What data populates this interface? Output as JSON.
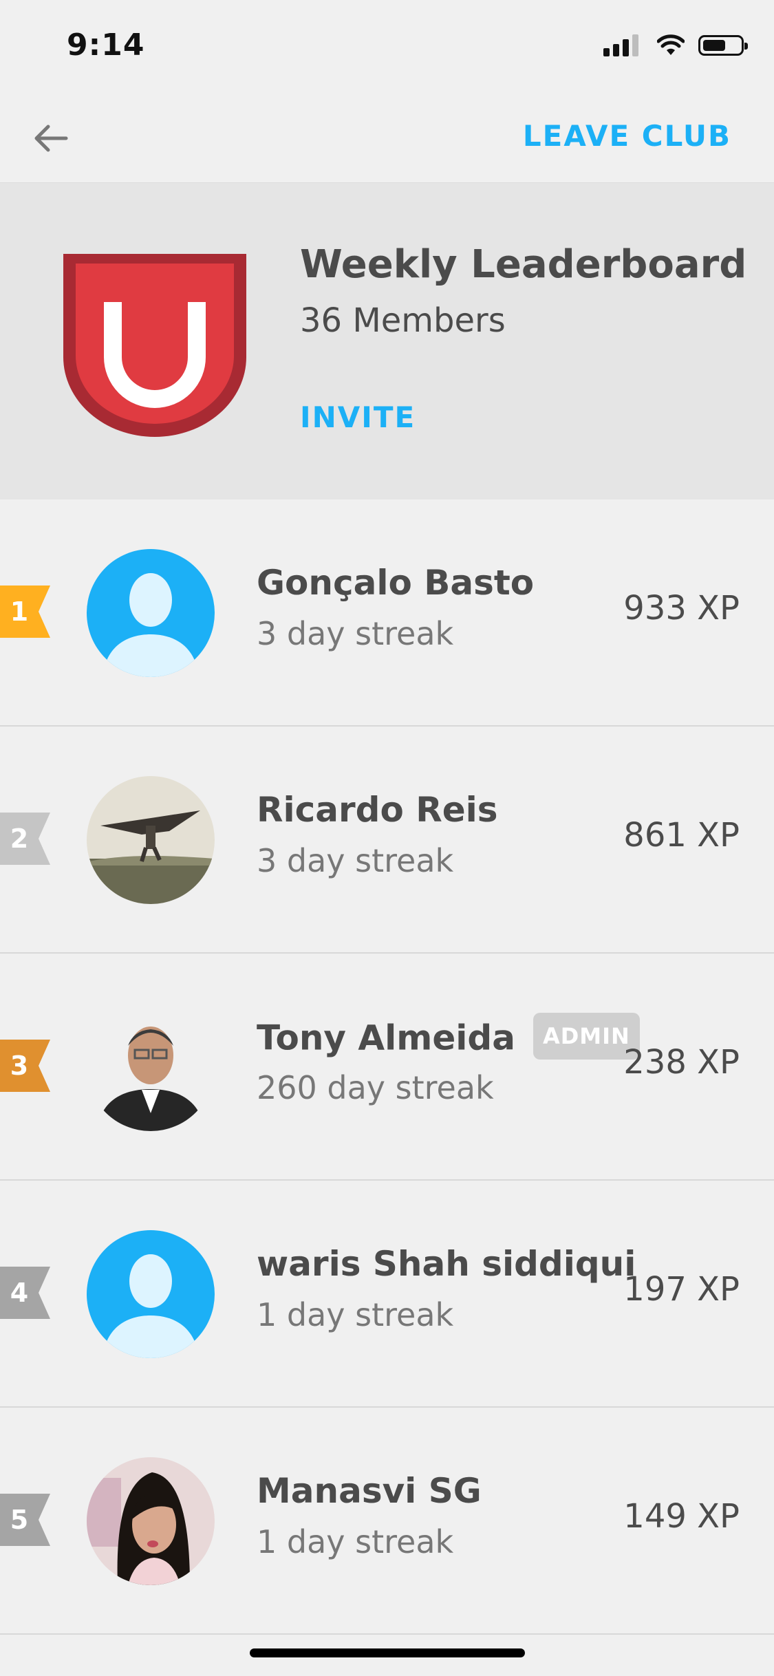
{
  "status_bar": {
    "time": "9:14"
  },
  "nav": {
    "back_icon": "arrow-left-icon",
    "leave_label": "LEAVE CLUB"
  },
  "club": {
    "title": "Weekly Leaderboard",
    "members": "36 Members",
    "invite_label": "INVITE",
    "badge_icon": "shield-icon",
    "badge_colors": {
      "outer": "#a82a33",
      "inner": "#e03b41",
      "letter": "#ffffff"
    }
  },
  "colors": {
    "accent": "#1cb0f6",
    "gold": "#ffb020",
    "silver": "#c5c5c5",
    "bronze": "#e0902f",
    "gray": "#a5a5a5",
    "avatar_default": "#1cb0f6"
  },
  "leaderboard": [
    {
      "rank": "1",
      "name": "Gonçalo Basto",
      "streak": "3 day streak",
      "xp": "933 XP",
      "avatar": "default-avatar-icon"
    },
    {
      "rank": "2",
      "name": "Ricardo Reis",
      "streak": "3 day streak",
      "xp": "861 XP",
      "avatar": "photo-avatar"
    },
    {
      "rank": "3",
      "name": "Tony Almeida",
      "admin": "ADMIN",
      "streak": "260 day streak",
      "xp": "238 XP",
      "avatar": "photo-avatar"
    },
    {
      "rank": "4",
      "name": "waris Shah siddiqui",
      "streak": "1 day streak",
      "xp": "197 XP",
      "avatar": "default-avatar-icon"
    },
    {
      "rank": "5",
      "name": "Manasvi SG",
      "streak": "1 day streak",
      "xp": "149 XP",
      "avatar": "photo-avatar"
    }
  ]
}
